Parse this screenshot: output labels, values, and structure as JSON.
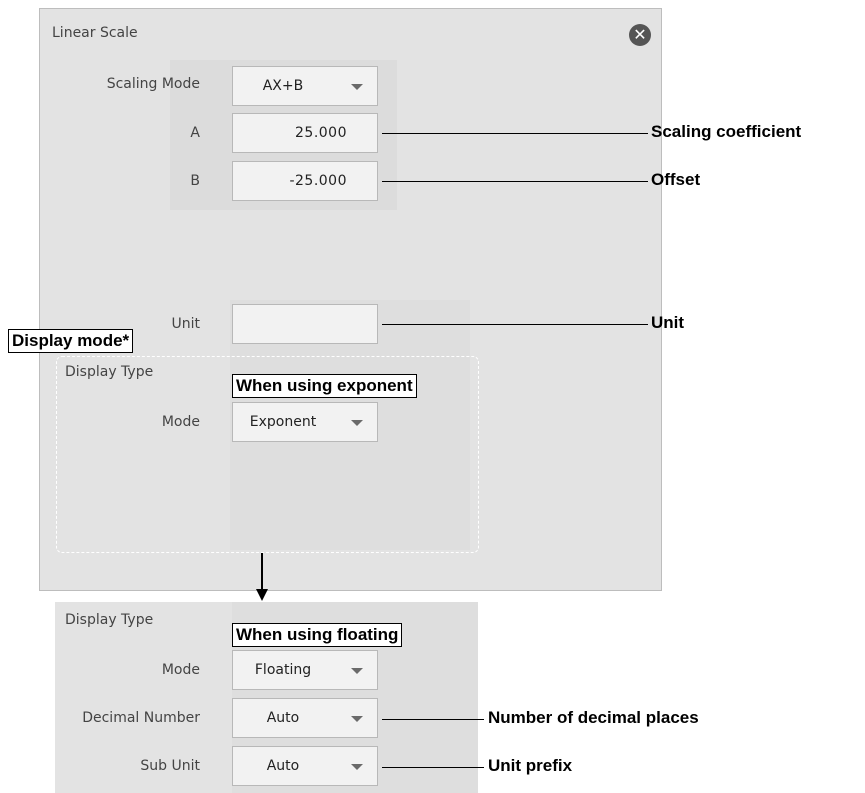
{
  "dialog": {
    "title": "Linear Scale",
    "close_icon": "close-icon",
    "scaling_mode": {
      "label": "Scaling Mode",
      "value": "AX+B"
    },
    "a": {
      "label": "A",
      "value": "25.000"
    },
    "b": {
      "label": "B",
      "value": "-25.000"
    },
    "unit": {
      "label": "Unit",
      "value": ""
    },
    "display_type": {
      "label": "Display Type",
      "mode": {
        "label": "Mode",
        "value": "Exponent"
      }
    }
  },
  "floating_panel": {
    "display_type_label": "Display Type",
    "mode": {
      "label": "Mode",
      "value": "Floating"
    },
    "decimal_number": {
      "label": "Decimal Number",
      "value": "Auto"
    },
    "sub_unit": {
      "label": "Sub Unit",
      "value": "Auto"
    }
  },
  "annotations": {
    "scaling_coefficient": "Scaling coefficient",
    "offset": "Offset",
    "unit": "Unit",
    "display_mode": "Display mode*",
    "when_exponent": "When using exponent",
    "when_floating": "When using floating",
    "decimal_places": "Number of decimal places",
    "unit_prefix": "Unit prefix"
  }
}
